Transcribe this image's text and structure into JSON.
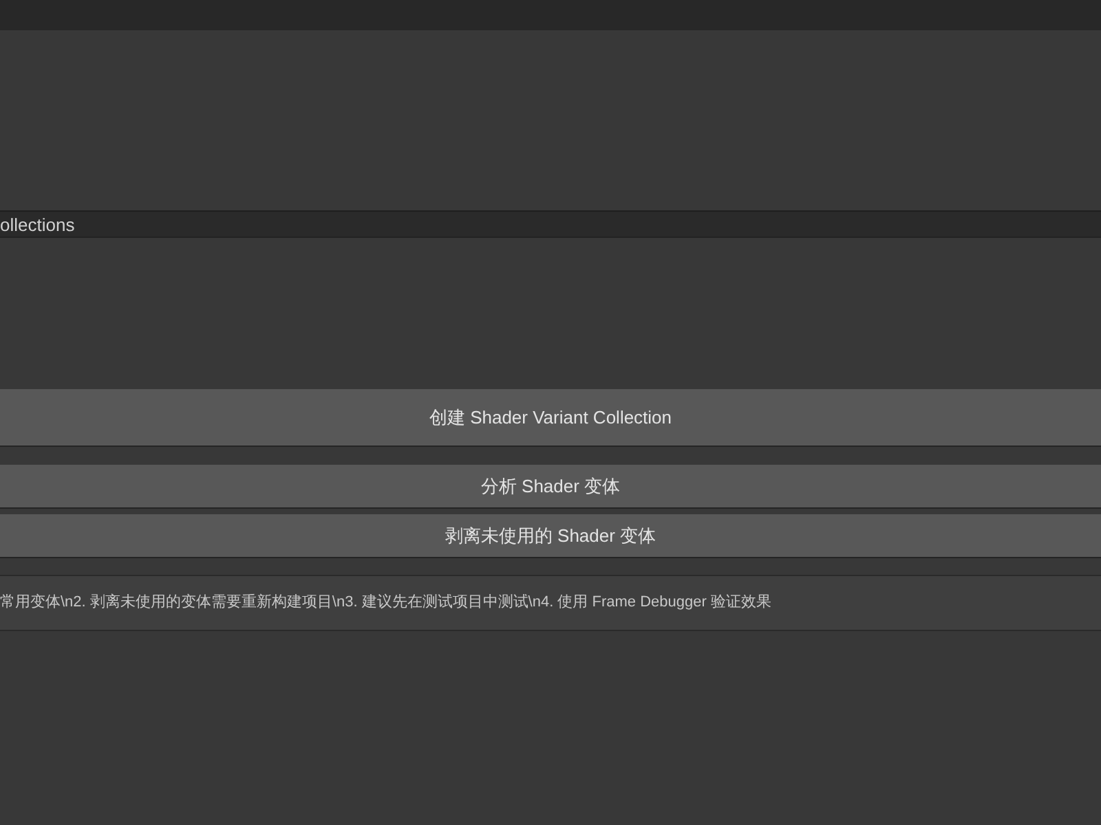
{
  "section_header": "ollections",
  "buttons": [
    "创建 Shader Variant Collection",
    "分析 Shader 变体",
    "剥离未使用的 Shader 变体"
  ],
  "help_text": "常用变体\\n2. 剥离未使用的变体需要重新构建项目\\n3. 建议先在测试项目中测试\\n4. 使用 Frame Debugger 验证效果"
}
